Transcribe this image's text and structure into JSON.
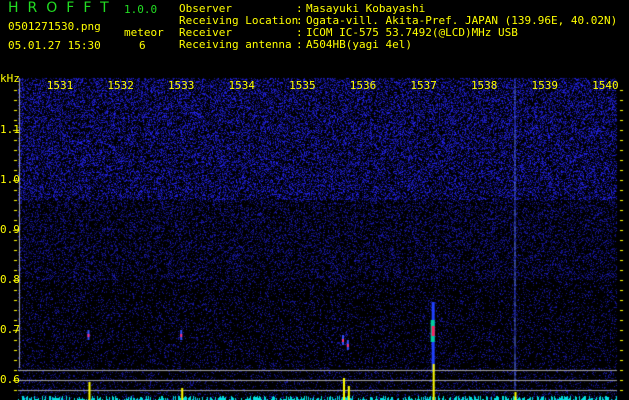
{
  "header": {
    "app_title": "HROFFT",
    "version": "1.0.0",
    "filename": "0501271530.png",
    "datetime": "05.01.27 15:30",
    "meteor_label": "meteor",
    "meteor_count": "6",
    "info": [
      {
        "label": "Observer",
        "value": "Masayuki Kobayashi"
      },
      {
        "label": "Receiving Location",
        "value": "Ogata-vill. Akita-Pref. JAPAN (139.96E, 40.02N)"
      },
      {
        "label": "Receiver",
        "value": "ICOM IC-575 53.7492(@LCD)MHz USB"
      },
      {
        "label": "Receiving antenna",
        "value": "A504HB(yagi 4el)"
      }
    ]
  },
  "colors": {
    "text": "#ffff00",
    "title": "#22dd22",
    "noise": "#2a2aff",
    "grid": "#a0a0a0",
    "histogram": "#00e0e0",
    "detection": "#ffff00"
  },
  "chart_data": {
    "type": "heatmap",
    "y_unit_label": "kHz",
    "x_ticks": [
      "1531",
      "1532",
      "1533",
      "1534",
      "1535",
      "1536",
      "1537",
      "1538",
      "1539",
      "1540"
    ],
    "y_ticks": [
      "1.1",
      "1.0",
      "0.9",
      "0.8",
      "0.7",
      "0.6"
    ],
    "ylim": [
      0.56,
      1.2
    ],
    "xlim": [
      1530.3,
      1540.2
    ],
    "reference_lines_khz": [
      0.62,
      0.6,
      0.58
    ],
    "meteor_echoes": [
      {
        "x": 1531.47,
        "y": 0.69
      },
      {
        "x": 1533.0,
        "y": 0.69
      },
      {
        "x": 1535.67,
        "y": 0.68
      },
      {
        "x": 1535.75,
        "y": 0.67
      },
      {
        "x": 1537.15,
        "y": 0.7
      },
      {
        "x": 1538.5,
        "y": 0.7
      }
    ],
    "carrier_line_x": 1538.5
  }
}
